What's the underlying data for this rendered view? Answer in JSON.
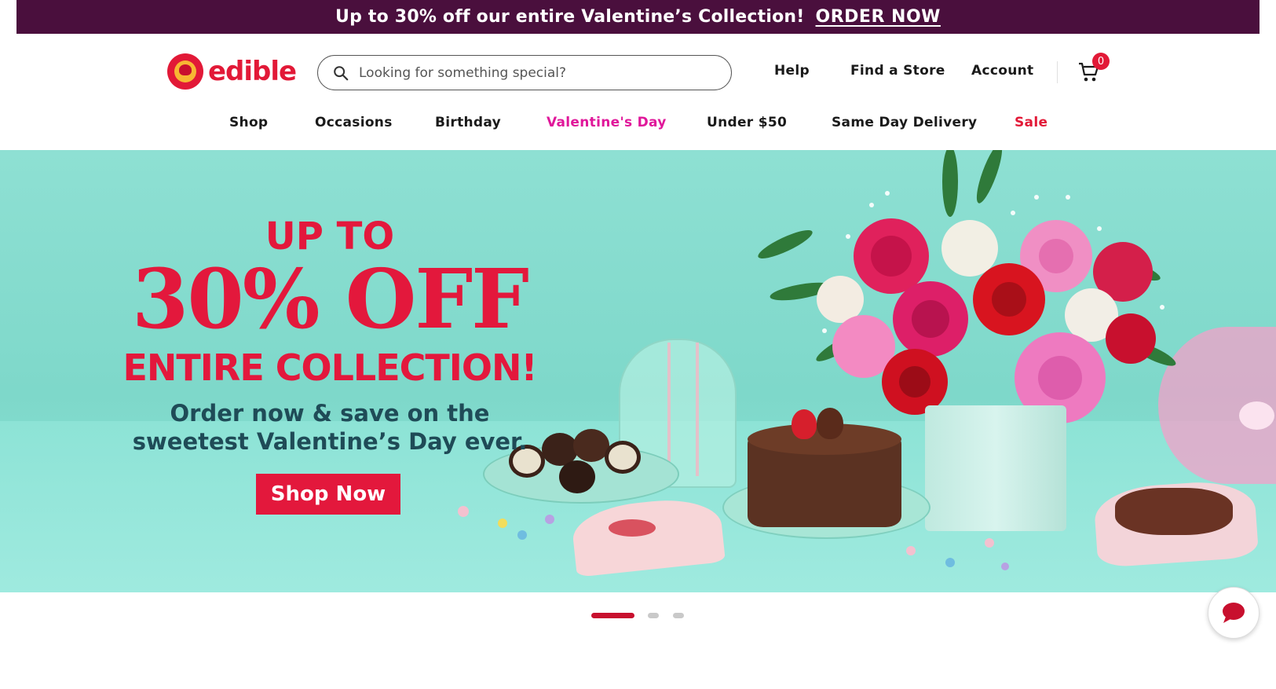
{
  "promo": {
    "text": "Up to 30% off our entire Valentine’s Collection!",
    "link": "ORDER NOW"
  },
  "logo": {
    "word": "edible"
  },
  "search": {
    "placeholder": "Looking for something special?"
  },
  "utility": {
    "help": "Help",
    "find_store": "Find a Store",
    "account": "Account",
    "cart_count": "0"
  },
  "nav": {
    "items": [
      {
        "label": "Shop",
        "color": "#1a1a1a"
      },
      {
        "label": "Occasions",
        "color": "#1a1a1a"
      },
      {
        "label": "Birthday",
        "color": "#1a1a1a"
      },
      {
        "label": "Valentine's Day",
        "color": "#e0179a"
      },
      {
        "label": "Under $50",
        "color": "#1a1a1a"
      },
      {
        "label": "Same Day Delivery",
        "color": "#1a1a1a"
      },
      {
        "label": "Sale",
        "color": "#e21937"
      }
    ]
  },
  "hero": {
    "line1": "UP TO",
    "line2": "30% OFF",
    "line3": "ENTIRE COLLECTION!",
    "sub1": "Order now & save on the",
    "sub2": "sweetest Valentine’s Day ever.",
    "cta": "Shop Now"
  },
  "carousel": {
    "slide_count": 3,
    "active": 1
  },
  "colors": {
    "promo_bg": "#4a0f3d",
    "brand_red": "#e21937",
    "hero_bg": "#8ee0d3",
    "valentine_pink": "#e0179a"
  },
  "icons": {
    "search": "search-icon",
    "cart": "cart-icon",
    "chat": "chat-icon"
  }
}
